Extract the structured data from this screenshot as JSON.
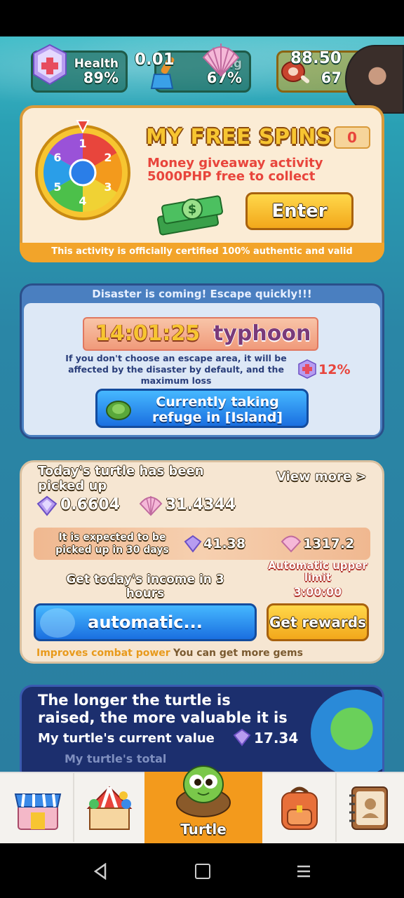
{
  "stats": {
    "health_label": "Health",
    "health_value": "89%",
    "center_value": "0.01",
    "cleaning_label": "ning",
    "cleaning_value": "67%",
    "food_value": "88.50",
    "food_percent": "67"
  },
  "free_spins": {
    "title": "MY FREE SPINS",
    "count": "0",
    "line1": "Money giveaway activity",
    "line2": "5000PHP free to collect",
    "enter_label": "Enter",
    "certified": "This activity is officially certified 100% authentic and valid",
    "wheel_numbers": [
      "1",
      "2",
      "3",
      "4",
      "5",
      "6"
    ]
  },
  "disaster": {
    "header": "Disaster is coming! Escape quickly!!!",
    "timer": "14:01:25",
    "type": "typhoon",
    "warning": "If you don't choose an escape area, it will be affected by the disaster by default, and the maximum loss",
    "loss_percent": "12%",
    "refuge_line1": "Currently taking",
    "refuge_line2": "refuge in [Island]"
  },
  "harvest": {
    "picked_title": "Today's turtle has been picked up",
    "view_more": "View more >",
    "gem_amount": "0.6604",
    "shell_amount": "31.4344",
    "expected_label": "It is expected to be picked up in 30 days",
    "expected_gems": "41.38",
    "expected_shells": "1317.2",
    "income_label": "Get today's income in 3 hours",
    "auto_limit_label": "Automatic upper limit",
    "auto_limit_time": "3:00:00",
    "automatic_label": "automatic...",
    "rewards_label": "Get rewards",
    "footer_left": "Improves combat power",
    "footer_right": "You can get more gems"
  },
  "value_card": {
    "line1": "The longer the turtle is",
    "line2": "raised, the more valuable it is",
    "current_label": "My turtle's current value",
    "current_value": "17.34",
    "total_label": "My turtle's total"
  },
  "nav": {
    "active_label": "Turtle"
  },
  "colors": {
    "accent_orange": "#f39a1c",
    "panel_cream": "#fbecd5",
    "panel_blue": "#dde8f6",
    "dark_navy": "#1c2f6e"
  }
}
